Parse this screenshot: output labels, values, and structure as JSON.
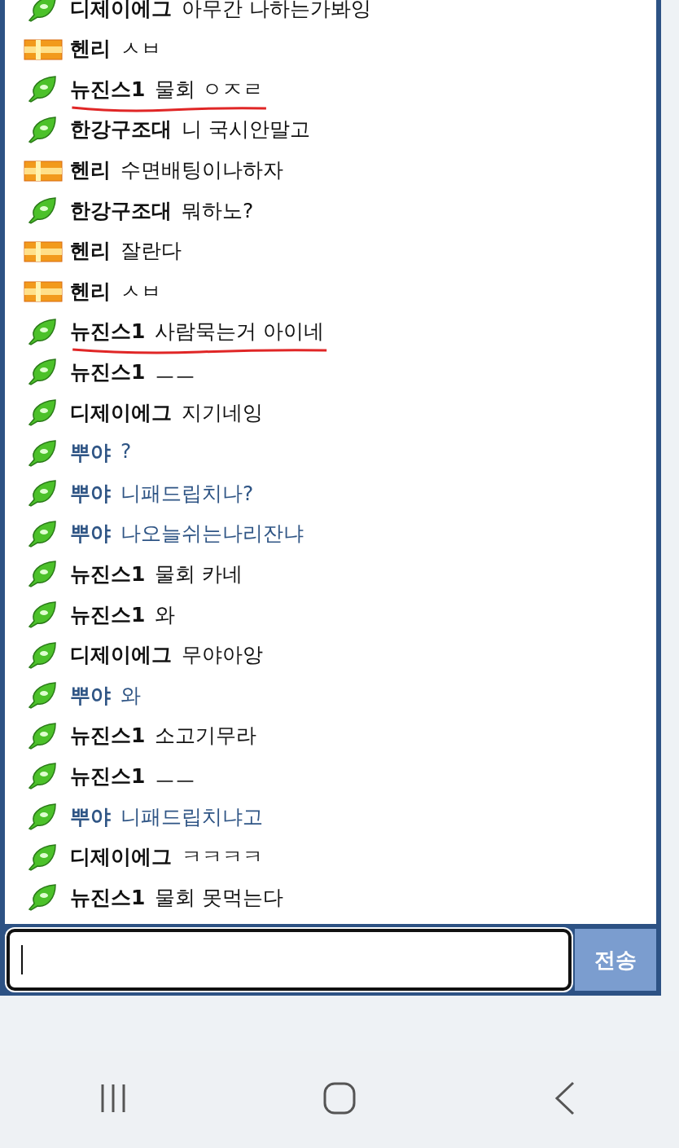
{
  "messages": [
    {
      "kind": "leaf",
      "name": "디제이에그",
      "text": "아무간 나하는가봐잉",
      "color": "#111111",
      "underlined": false
    },
    {
      "kind": "bars",
      "name": "헨리",
      "text": "ㅅㅂ",
      "color": "#111111",
      "underlined": false
    },
    {
      "kind": "leaf",
      "name": "뉴진스1",
      "text": "물회 ㅇㅈㄹ",
      "color": "#111111",
      "underlined": true
    },
    {
      "kind": "leaf",
      "name": "한강구조대",
      "text": "니 국시안말고",
      "color": "#111111",
      "underlined": false
    },
    {
      "kind": "bars",
      "name": "헨리",
      "text": "수면배팅이나하자",
      "color": "#111111",
      "underlined": false
    },
    {
      "kind": "leaf",
      "name": "한강구조대",
      "text": "뭐하노?",
      "color": "#111111",
      "underlined": false
    },
    {
      "kind": "bars",
      "name": "헨리",
      "text": "잘란다",
      "color": "#111111",
      "underlined": false
    },
    {
      "kind": "bars",
      "name": "헨리",
      "text": "ㅅㅂ",
      "color": "#111111",
      "underlined": false
    },
    {
      "kind": "leaf",
      "name": "뉴진스1",
      "text": "사람묵는거 아이네",
      "color": "#111111",
      "underlined": true
    },
    {
      "kind": "leaf",
      "name": "뉴진스1",
      "text": "ㅡㅡ",
      "color": "#111111",
      "underlined": false
    },
    {
      "kind": "leaf",
      "name": "디제이에그",
      "text": "지기네잉",
      "color": "#111111",
      "underlined": false
    },
    {
      "kind": "leaf",
      "name": "뿌야",
      "text": "?",
      "color": "#2f5585",
      "underlined": false
    },
    {
      "kind": "leaf",
      "name": "뿌야",
      "text": "니패드립치나?",
      "color": "#2f5585",
      "underlined": false
    },
    {
      "kind": "leaf",
      "name": "뿌야",
      "text": "나오늘쉬는나리잔냐",
      "color": "#2f5585",
      "underlined": false
    },
    {
      "kind": "leaf",
      "name": "뉴진스1",
      "text": "물회 카네",
      "color": "#111111",
      "underlined": false
    },
    {
      "kind": "leaf",
      "name": "뉴진스1",
      "text": "와",
      "color": "#111111",
      "underlined": false
    },
    {
      "kind": "leaf",
      "name": "디제이에그",
      "text": "무야아앙",
      "color": "#111111",
      "underlined": false
    },
    {
      "kind": "leaf",
      "name": "뿌야",
      "text": "와",
      "color": "#2f5585",
      "underlined": false
    },
    {
      "kind": "leaf",
      "name": "뉴진스1",
      "text": "소고기무라",
      "color": "#111111",
      "underlined": false
    },
    {
      "kind": "leaf",
      "name": "뉴진스1",
      "text": "ㅡㅡ",
      "color": "#111111",
      "underlined": false
    },
    {
      "kind": "leaf",
      "name": "뿌야",
      "text": "니패드립치냐고",
      "color": "#2f5585",
      "underlined": false
    },
    {
      "kind": "leaf",
      "name": "디제이에그",
      "text": "ㅋㅋㅋㅋ",
      "color": "#111111",
      "underlined": false
    },
    {
      "kind": "leaf",
      "name": "뉴진스1",
      "text": "물회 못먹는다",
      "color": "#111111",
      "underlined": false
    }
  ],
  "composer": {
    "send_label": "전송"
  }
}
